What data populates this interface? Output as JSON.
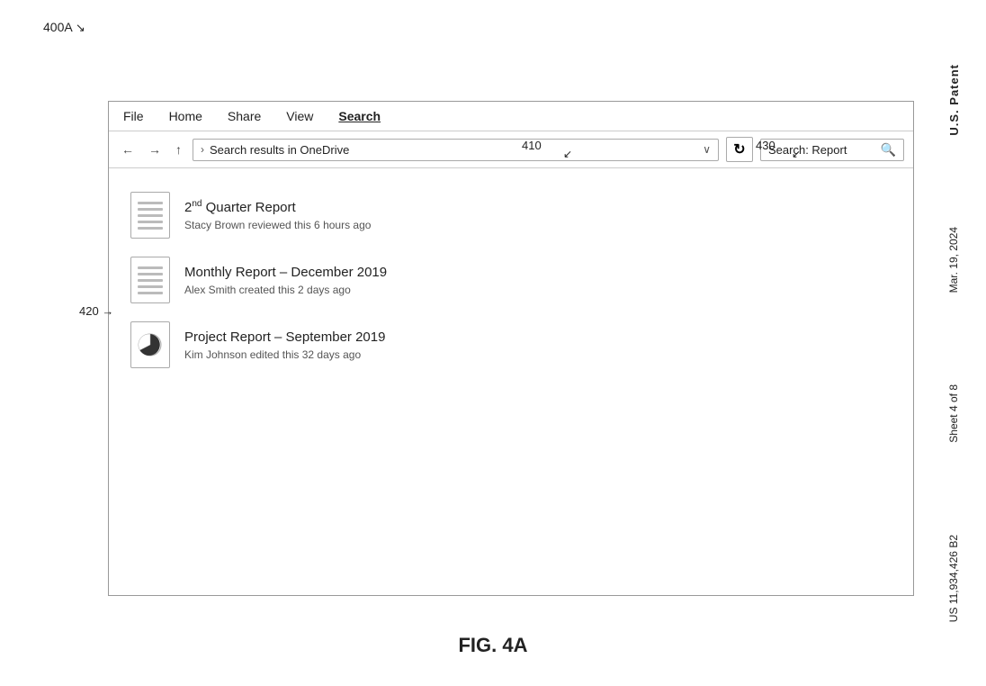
{
  "diagram_label": "400A",
  "figure_caption": "FIG. 4A",
  "callouts": {
    "label_400a": "400A",
    "label_410": "410",
    "label_420": "420",
    "label_430": "430"
  },
  "patent_info": {
    "us_patent": "U.S. Patent",
    "date": "Mar. 19, 2024",
    "sheet": "Sheet 4 of 8",
    "patent_number": "US 11,934,426 B2"
  },
  "menubar": {
    "items": [
      {
        "label": "File",
        "active": false
      },
      {
        "label": "Home",
        "active": false
      },
      {
        "label": "Share",
        "active": false
      },
      {
        "label": "View",
        "active": false
      },
      {
        "label": "Search",
        "active": true
      }
    ]
  },
  "toolbar": {
    "back_btn": "←",
    "forward_btn": "→",
    "up_btn": "↑",
    "address_text": "Search results in OneDrive",
    "dropdown_char": "∨",
    "refresh_char": "↻",
    "search_label": "Search: Report",
    "search_icon": "🔍"
  },
  "files": [
    {
      "name_prefix": "2",
      "name_sup": "nd",
      "name_suffix": " Quarter Report",
      "meta": "Stacy Brown reviewed this 6 hours ago",
      "type": "lines"
    },
    {
      "name_prefix": "Monthly Report",
      "name_sep": " – ",
      "name_suffix": "December 2019",
      "meta": "Alex Smith created this 2 days ago",
      "type": "lines"
    },
    {
      "name_prefix": "Project Report",
      "name_sep": " – ",
      "name_suffix": "September 2019",
      "meta": "Kim Johnson edited this 32 days ago",
      "type": "chart"
    }
  ]
}
